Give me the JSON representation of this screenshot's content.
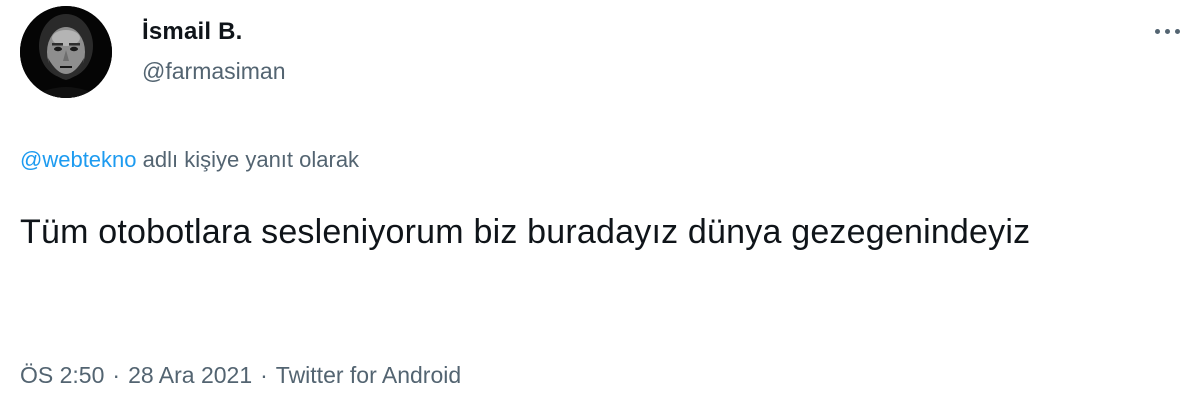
{
  "author": {
    "display_name": "İsmail B.",
    "handle": "@farmasiman",
    "avatar_icon": "profile-photo"
  },
  "more_icon": "more-options-icon",
  "reply": {
    "mention": "@webtekno",
    "suffix": " adlı kişiye yanıt olarak"
  },
  "tweet": {
    "text": "Tüm otobotlara sesleniyorum biz buradayız dünya gezegenindeyiz"
  },
  "meta": {
    "time": "ÖS 2:50",
    "separator": "·",
    "date": "28 Ara 2021",
    "source": "Twitter for Android"
  },
  "colors": {
    "text_primary": "#0f1419",
    "text_secondary": "#536471",
    "link": "#1d9bf0",
    "background": "#ffffff"
  }
}
